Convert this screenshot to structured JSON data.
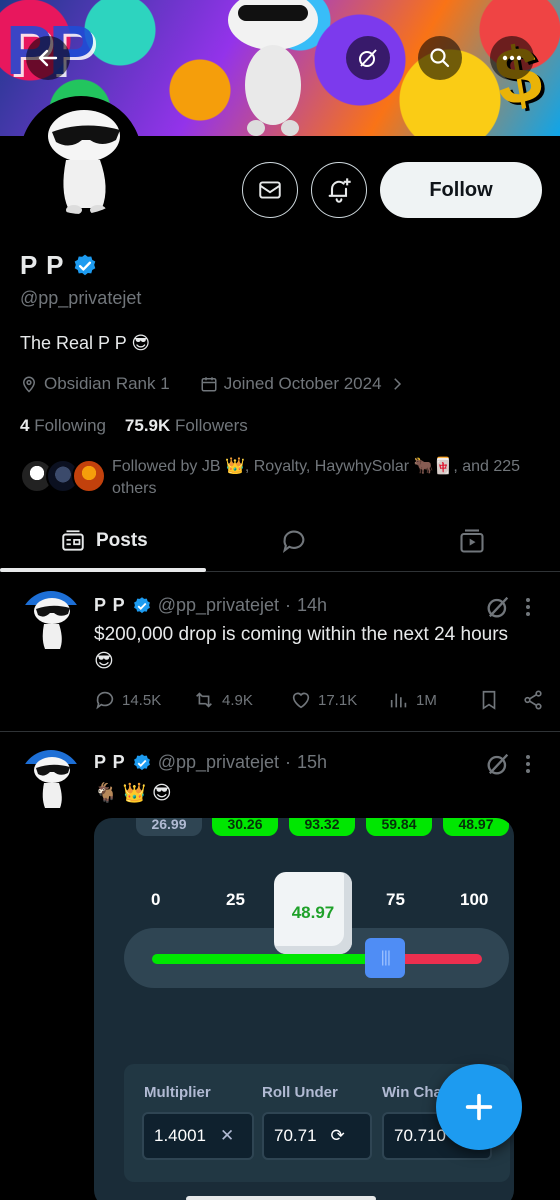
{
  "banner": {
    "graffiti_left": "PP",
    "graffiti_right": "$"
  },
  "profile": {
    "name": "P P",
    "handle": "@pp_privatejet",
    "bio": "The Real P P 😎",
    "location": "Obsidian Rank 1",
    "joined": "Joined October 2024",
    "following_count": "4",
    "following_label": "Following",
    "followers_count": "75.9K",
    "followers_label": "Followers",
    "followed_by": "Followed by JB 👑, Royalty, HaywhySolar 🐂🀄, and 225 others",
    "follow_label": "Follow"
  },
  "tabs": {
    "posts_label": "Posts"
  },
  "posts": [
    {
      "name": "P P",
      "handle": "@pp_privatejet",
      "time": "14h",
      "text": "$200,000 drop is coming within the next 24 hours 😎",
      "replies": "14.5K",
      "reposts": "4.9K",
      "likes": "17.1K",
      "views": "1M"
    },
    {
      "name": "P P",
      "handle": "@pp_privatejet",
      "time": "15h",
      "text": "🐐 👑 😎"
    }
  ],
  "game": {
    "top_pills": [
      "26.99",
      "30.26",
      "93.32",
      "59.84",
      "48.97"
    ],
    "scale": [
      "0",
      "25",
      "75",
      "100"
    ],
    "dice_value": "48.97",
    "slider_handle": "|||",
    "roll_under_fraction": 0.7071,
    "multiplier_label": "Multiplier",
    "multiplier_value": "1.4001",
    "roll_under_label": "Roll Under",
    "roll_under_value": "70.71",
    "win_chance_label": "Win Cha",
    "win_chance_value": "70.710",
    "colors": {
      "win": "#00e701",
      "lose": "#ed2f4f",
      "bg": "#1a2c38"
    }
  },
  "colors": {
    "accent": "#1d9bf0",
    "muted": "#71767b",
    "text": "#e7e9ea"
  }
}
